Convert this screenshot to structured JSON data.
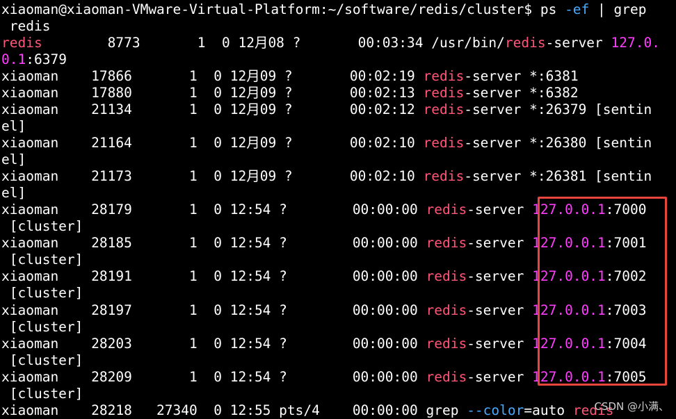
{
  "prompt": {
    "text": "xiaoman@xiaoman-VMware-Virtual-Platform:~/software/redis/cluster$ ps ",
    "flag": "-ef",
    "pipe": " | grep",
    "cont": " redis"
  },
  "rows": {
    "r1": {
      "user": "redis",
      "mid": "        8773       1  0 12月08 ?       00:03:34 /usr/bin/",
      "hl": "redis",
      "post": "-server ",
      "ip": "127.0.",
      "ip_cont": "0.1",
      "port": ":6379"
    },
    "r2": {
      "pre": "xiaoman    17866       1  0 12月09 ?       00:02:19 ",
      "hl": "redis",
      "post": "-server *:6381"
    },
    "r3": {
      "pre": "xiaoman    17880       1  0 12月09 ?       00:02:13 ",
      "hl": "redis",
      "post": "-server *:6382"
    },
    "r4": {
      "pre": "xiaoman    21134       1  0 12月09 ?       00:02:12 ",
      "hl": "redis",
      "post": "-server *:26379 [sentin",
      "cont": "el]"
    },
    "r5": {
      "pre": "xiaoman    21164       1  0 12月09 ?       00:02:10 ",
      "hl": "redis",
      "post": "-server *:26380 [sentin",
      "cont": "el]"
    },
    "r6": {
      "pre": "xiaoman    21173       1  0 12月09 ?       00:02:10 ",
      "hl": "redis",
      "post": "-server *:26381 [sentin",
      "cont": "el]"
    },
    "c0": {
      "pre": "xiaoman    28179       1  0 12:54 ?        00:00:00 ",
      "hl": "redis",
      "post": "-server ",
      "ip": "127.0.0.1",
      "port": ":7000",
      "cont": " [cluster]"
    },
    "c1": {
      "pre": "xiaoman    28185       1  0 12:54 ?        00:00:00 ",
      "hl": "redis",
      "post": "-server ",
      "ip": "127.0.0.1",
      "port": ":7001",
      "cont": " [cluster]"
    },
    "c2": {
      "pre": "xiaoman    28191       1  0 12:54 ?        00:00:00 ",
      "hl": "redis",
      "post": "-server ",
      "ip": "127.0.0.1",
      "port": ":7002",
      "cont": " [cluster]"
    },
    "c3": {
      "pre": "xiaoman    28197       1  0 12:54 ?        00:00:00 ",
      "hl": "redis",
      "post": "-server ",
      "ip": "127.0.0.1",
      "port": ":7003",
      "cont": " [cluster]"
    },
    "c4": {
      "pre": "xiaoman    28203       1  0 12:54 ?        00:00:00 ",
      "hl": "redis",
      "post": "-server ",
      "ip": "127.0.0.1",
      "port": ":7004",
      "cont": " [cluster]"
    },
    "c5": {
      "pre": "xiaoman    28209       1  0 12:54 ?        00:00:00 ",
      "hl": "redis",
      "post": "-server ",
      "ip": "127.0.0.1",
      "port": ":7005",
      "cont": " [cluster]"
    },
    "last": {
      "pre": "xiaoman    28218   27340  0 12:55 pts/4    00:00:00 grep ",
      "flag": "--color",
      "post": "=auto ",
      "hl": "redis"
    }
  },
  "watermark": "CSDN @小满、",
  "colors": {
    "background": "#000000",
    "text": "#ffffff",
    "match_highlight": "#ff5577",
    "ip_highlight": "#ff3dff",
    "option": "#47aaff",
    "annotation_box": "#e8453c"
  }
}
